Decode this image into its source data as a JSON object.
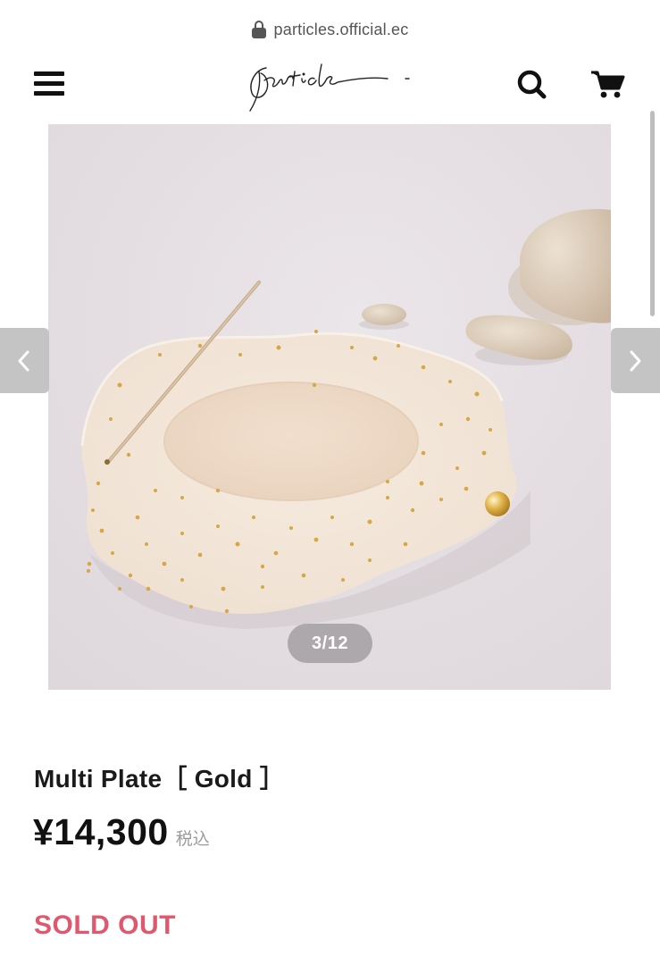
{
  "browser": {
    "url": "particles.official.ec",
    "icon": "lock-icon"
  },
  "header": {
    "menu_icon": "hamburger-menu-icon",
    "logo_alt": "Particle",
    "search_icon": "search-icon",
    "cart_icon": "cart-icon"
  },
  "gallery": {
    "counter": "3/12",
    "current_index": 3,
    "total": 12,
    "prev_icon": "chevron-left-icon",
    "next_icon": "chevron-right-icon"
  },
  "product": {
    "title": "Multi Plate［ Gold ］",
    "price": "¥14,300",
    "tax_note": "税込",
    "status": "SOLD OUT"
  },
  "colors": {
    "sold_out": "#e0586e",
    "price_text": "#111111",
    "tax_text": "#9a9a9a",
    "arrow_bg": "#c4c4c4"
  }
}
